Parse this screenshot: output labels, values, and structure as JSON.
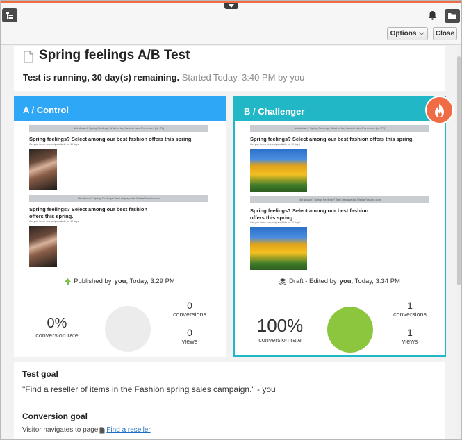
{
  "toolbar": {
    "options_label": "Options",
    "close_label": "Close"
  },
  "header": {
    "title": "Spring feelings A/B Test",
    "status_bold": "Test is running, 30 day(s) remaining.",
    "status_muted": "Started Today, 3:40 PM by you"
  },
  "variants": [
    {
      "name": "A / Control",
      "email_bar": "Not shown? Spring Feelings, What to buy here at LabelForm.com (for TV)",
      "email_heading": "Spring feelings? Select among our best fashion offers this spring.",
      "email_small": "Get your items now, only available for 10 days!",
      "email_bar2": "Not shown? Spring Feelings? Just displayed at MediaFashion.com",
      "email_heading2a": "Spring feelings? Select among our best fashion",
      "email_heading2b": "offers this spring.",
      "email_small2": "Get your items now, only available for 10 days!",
      "status_prefix": "Published by",
      "status_user": "you",
      "status_time": ", Today, 3:29 PM",
      "rate": "0%",
      "rate_label": "conversion rate",
      "conversions": "0",
      "conversions_label": "conversions",
      "views": "0",
      "views_label": "views",
      "circle_color": "#ececec"
    },
    {
      "name": "B / Challenger",
      "email_bar": "Not shown? Spring Feelings, What to buy here at LabelForm.com (for TV)",
      "email_heading": "Spring feelings? Select among our best fashion offers this spring.",
      "email_small": "Get your items now, only available for 10 days!",
      "email_bar2": "Not shown? Spring Feelings? Just displayed at MediaFashion.com",
      "email_heading2a": "Spring feelings? Select among our best fashion",
      "email_heading2b": "offers this spring.",
      "email_small2": "Get your items now, only available for 10 days!",
      "status_prefix": "Draft - Edited by",
      "status_user": "you",
      "status_time": ", Today, 3:34 PM",
      "rate": "100%",
      "rate_label": "conversion rate",
      "conversions": "1",
      "conversions_label": "conversions",
      "views": "1",
      "views_label": "views",
      "circle_color": "#8cc63f"
    }
  ],
  "goals": {
    "test_goal_heading": "Test goal",
    "test_goal_text": "\"Find a reseller of items in the Fashion spring sales campaign.\" - you",
    "conversion_goal_heading": "Conversion goal",
    "conversion_goal_prefix": "Visitor navigates to page",
    "conversion_goal_link": "Find a reseller"
  },
  "colors": {
    "accent_orange": "#ef6c45",
    "control_blue": "#2ea7f7",
    "challenger_teal": "#22b7c7",
    "success_green": "#8cc63f"
  },
  "icons": [
    "tree-icon",
    "collapse-arrow-icon",
    "bell-icon",
    "folder-icon",
    "document-icon",
    "fire-icon",
    "arrow-up-icon",
    "stack-icon",
    "page-icon",
    "chevron-down-icon"
  ]
}
